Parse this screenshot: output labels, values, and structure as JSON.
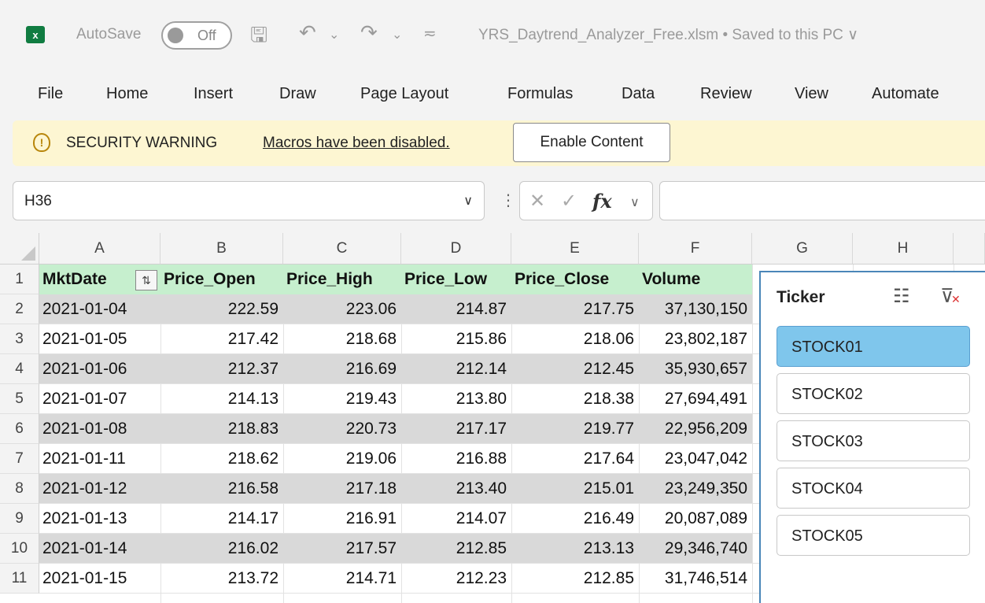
{
  "titlebar": {
    "logo": "x",
    "autosave_label": "AutoSave",
    "autosave_state": "Off",
    "doc_title": "YRS_Daytrend_Analyzer_Free.xlsm • Saved to this PC ∨"
  },
  "menu": [
    "File",
    "Home",
    "Insert",
    "Draw",
    "Page Layout",
    "Formulas",
    "Data",
    "Review",
    "View",
    "Automate"
  ],
  "security": {
    "title": "SECURITY WARNING",
    "message": "Macros have been disabled.",
    "button": "Enable Content"
  },
  "formula_bar": {
    "name_box": "H36",
    "fx": "fx",
    "formula": ""
  },
  "columns": [
    "A",
    "B",
    "C",
    "D",
    "E",
    "F",
    "G",
    "H"
  ],
  "header_row": [
    "MktDate",
    "Price_Open",
    "Price_High",
    "Price_Low",
    "Price_Close",
    "Volume"
  ],
  "rows": [
    {
      "n": "2",
      "cells": [
        "2021-01-04",
        "222.59",
        "223.06",
        "214.87",
        "217.75",
        "37,130,150"
      ]
    },
    {
      "n": "3",
      "cells": [
        "2021-01-05",
        "217.42",
        "218.68",
        "215.86",
        "218.06",
        "23,802,187"
      ]
    },
    {
      "n": "4",
      "cells": [
        "2021-01-06",
        "212.37",
        "216.69",
        "212.14",
        "212.45",
        "35,930,657"
      ]
    },
    {
      "n": "5",
      "cells": [
        "2021-01-07",
        "214.13",
        "219.43",
        "213.80",
        "218.38",
        "27,694,491"
      ]
    },
    {
      "n": "6",
      "cells": [
        "2021-01-08",
        "218.83",
        "220.73",
        "217.17",
        "219.77",
        "22,956,209"
      ]
    },
    {
      "n": "7",
      "cells": [
        "2021-01-11",
        "218.62",
        "219.06",
        "216.88",
        "217.64",
        "23,047,042"
      ]
    },
    {
      "n": "8",
      "cells": [
        "2021-01-12",
        "216.58",
        "217.18",
        "213.40",
        "215.01",
        "23,249,350"
      ]
    },
    {
      "n": "9",
      "cells": [
        "2021-01-13",
        "214.17",
        "216.91",
        "214.07",
        "216.49",
        "20,087,089"
      ]
    },
    {
      "n": "10",
      "cells": [
        "2021-01-14",
        "216.02",
        "217.57",
        "212.85",
        "213.13",
        "29,346,740"
      ]
    },
    {
      "n": "11",
      "cells": [
        "2021-01-15",
        "213.72",
        "214.71",
        "212.23",
        "212.85",
        "31,746,514"
      ]
    }
  ],
  "slicer": {
    "title": "Ticker",
    "items": [
      "STOCK01",
      "STOCK02",
      "STOCK03",
      "STOCK04",
      "STOCK05"
    ],
    "selected": "STOCK01",
    "selected_color": "#7fc6ec",
    "border_color": "#4a86b8"
  },
  "colors": {
    "header_fill": "#c6efce",
    "band_fill": "#d9d9d9",
    "excel_green": "#107c41",
    "warning_bar": "#fdf6d2"
  },
  "icons": {
    "save": "save-icon",
    "undo": "undo-icon",
    "redo": "redo-icon",
    "warning": "shield-warning-icon",
    "multiselect": "multi-select-icon",
    "clear_filter": "clear-filter-icon"
  }
}
